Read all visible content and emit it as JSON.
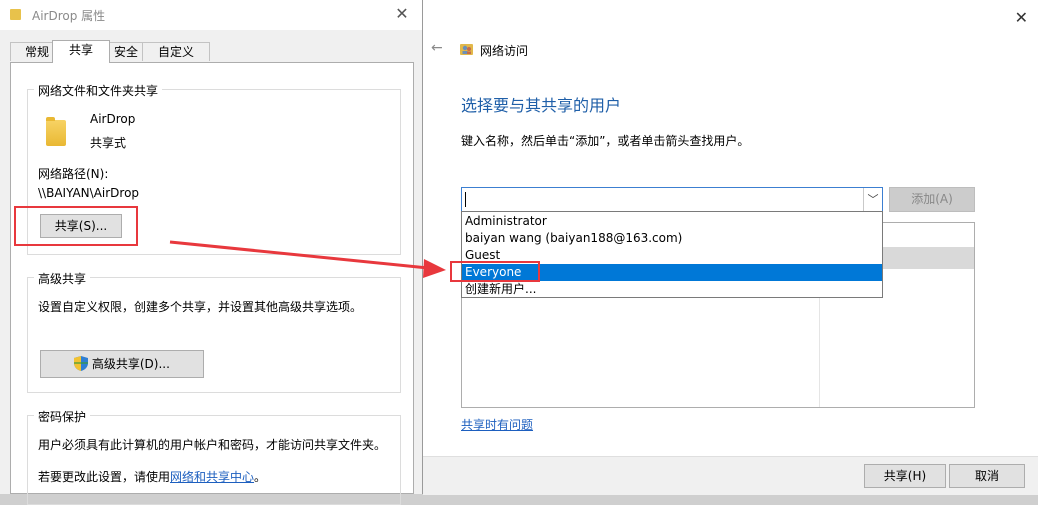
{
  "props_window": {
    "title": "AirDrop 属性",
    "tabs": [
      "常规",
      "共享",
      "安全",
      "自定义"
    ],
    "active_tab": "共享",
    "network_group": {
      "title": "网络文件和文件夹共享",
      "folder_name": "AirDrop",
      "folder_state": "共享式",
      "path_label": "网络路径(N):",
      "path_value": "\\\\BAIYAN\\AirDrop",
      "share_button": "共享(S)..."
    },
    "advanced_group": {
      "title": "高级共享",
      "description": "设置自定义权限，创建多个共享，并设置其他高级共享选项。",
      "button": "高级共享(D)..."
    },
    "password_group": {
      "title": "密码保护",
      "description": "用户必须具有此计算机的用户帐户和密码，才能访问共享文件夹。",
      "change_prefix": "若要更改此设置，请使用",
      "change_link": "网络和共享中心",
      "change_suffix": "。"
    }
  },
  "share_window": {
    "breadcrumb": "网络访问",
    "heading": "选择要与其共享的用户",
    "instruction": "键入名称，然后单击“添加”，或者单击箭头查找用户。",
    "input_value": "",
    "add_button": "添加(A)",
    "dropdown_options": [
      "Administrator",
      "baiyan wang (baiyan188@163.com)",
      "Guest",
      "Everyone",
      "创建新用户..."
    ],
    "highlighted_option": "Everyone",
    "trouble_link": "共享时有问题",
    "share_button": "共享(H)",
    "cancel_button": "取消"
  },
  "colors": {
    "accent": "#0078d7",
    "heading_blue": "#1f5fa8",
    "annotation_red": "#e8383d"
  }
}
